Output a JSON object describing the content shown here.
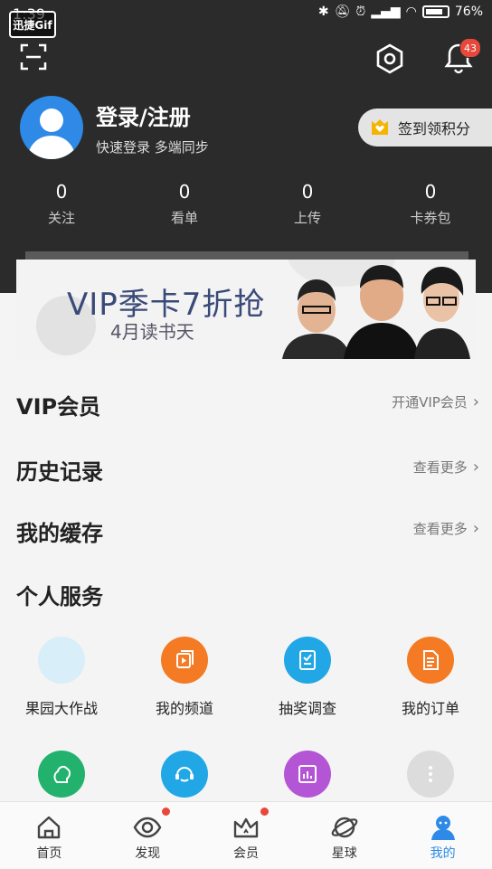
{
  "statusbar": {
    "time": "1:39",
    "gif_mark": "迅捷Gif",
    "battery": "76%"
  },
  "header": {
    "notification_count": "43",
    "login_title": "登录/注册",
    "login_subtitle": "快速登录 多端同步",
    "signin_label": "签到领积分"
  },
  "stats": [
    {
      "value": "0",
      "label": "关注"
    },
    {
      "value": "0",
      "label": "看单"
    },
    {
      "value": "0",
      "label": "上传"
    },
    {
      "value": "0",
      "label": "卡券包"
    }
  ],
  "banner": {
    "title": "VIP季卡7折抢",
    "subtitle": "4月读书天"
  },
  "menu": {
    "vip": {
      "title": "VIP会员",
      "link": "开通VIP会员"
    },
    "history": {
      "title": "历史记录",
      "link": "查看更多"
    },
    "cache": {
      "title": "我的缓存",
      "link": "查看更多"
    },
    "services_title": "个人服务"
  },
  "services": [
    {
      "label": "果园大作战",
      "icon": "orchard-icon",
      "color": "#d8eef8"
    },
    {
      "label": "我的频道",
      "icon": "channel-icon",
      "color": "#f47a24"
    },
    {
      "label": "抽奖调查",
      "icon": "survey-icon",
      "color": "#21a7e6"
    },
    {
      "label": "我的订单",
      "icon": "order-icon",
      "color": "#f47a24"
    }
  ],
  "services_row2_colors": [
    "#23b26d",
    "#21a7e6",
    "#b455d6",
    "#dcdcdc"
  ],
  "tabs": [
    {
      "label": "首页",
      "icon": "home-icon"
    },
    {
      "label": "发现",
      "icon": "eye-icon"
    },
    {
      "label": "会员",
      "icon": "crown-icon"
    },
    {
      "label": "星球",
      "icon": "planet-icon"
    },
    {
      "label": "我的",
      "icon": "profile-icon"
    }
  ],
  "colors": {
    "accent": "#2e8ae6",
    "dark_header": "#2b2b2b",
    "badge": "#e8483c"
  }
}
